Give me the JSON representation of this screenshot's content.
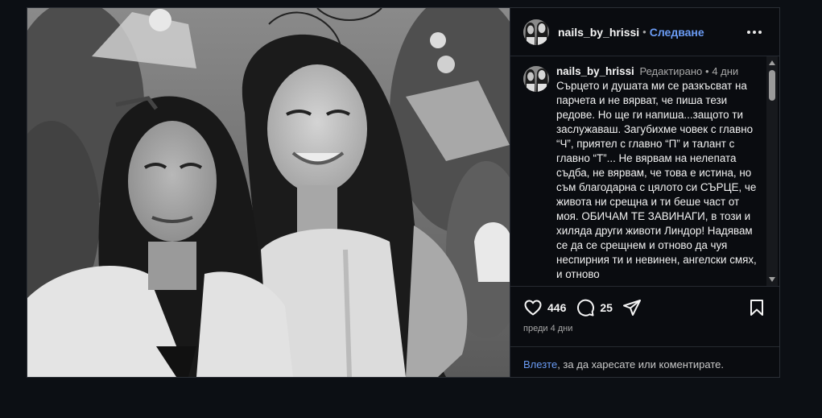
{
  "post": {
    "username": "nails_by_hrissi",
    "follow_label": "Следване",
    "separator": "•",
    "caption": {
      "username": "nails_by_hrissi",
      "edited": "Редактирано",
      "separator": "•",
      "age": "4 дни",
      "text": "Сърцето и душата ми се разкъсват на парчета и не вярват, че пиша тези редове. Но ще ги напиша...защото ти заслужаваш. Загубихме човек с главно “Ч”, приятел с главно “П” и талант с главно “Т”... Не вярвам на нелепата съдба, не вярвам, че това е истина, но съм благодарна с цялото си СЪРЦЕ, че живота ни срещна и ти беше част от моя. ОБИЧАМ ТЕ ЗАВИНАГИ, в този и хиляда други животи Линдор! Надявам се да се срещнем и отново да чуя неспирния ти и невинен, ангелски смях, и отново"
    },
    "likes": "446",
    "comments_count": "25",
    "timestamp": "преди 4 дни",
    "login": {
      "link": "Влезте",
      "text": ", за да харесате или коментирате."
    }
  },
  "icons": {
    "more": "more-options-icon",
    "like": "heart-icon",
    "comment": "comment-icon",
    "share": "share-icon",
    "save": "bookmark-icon"
  },
  "colors": {
    "accent": "#6b9cf5",
    "background": "#0a0c10",
    "text": "#f5f5f5",
    "muted": "#a8a8a8"
  }
}
